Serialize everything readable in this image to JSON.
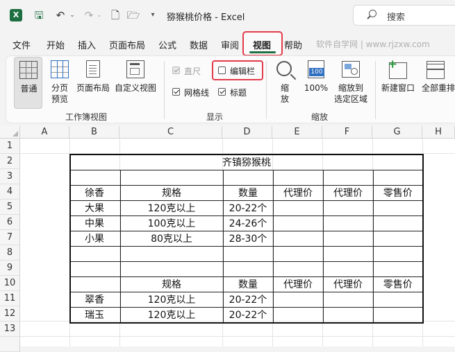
{
  "titlebar": {
    "app_icon": "excel-logo-icon",
    "app_icon_letter": "X",
    "doc_title": "猕猴桃价格  -  Excel",
    "search_placeholder": "搜索",
    "quick_access": {
      "save_icon": "save-icon",
      "undo_icon": "undo-icon",
      "redo_icon": "redo-icon",
      "new_icon": "new-document-icon",
      "open_icon": "open-folder-icon",
      "more_icon": "customize-quick-access-icon"
    }
  },
  "menu": {
    "tabs": [
      "文件",
      "开始",
      "插入",
      "页面布局",
      "公式",
      "数据",
      "审阅",
      "视图",
      "帮助"
    ],
    "active_tab": "视图",
    "watermark": "软件自学网 | www.rjzxw.com"
  },
  "ribbon": {
    "workbook_views": {
      "normal": "普通",
      "page_break_line1": "分页",
      "page_break_line2": "预览",
      "page_layout": "页面布局",
      "custom_views": "自定义视图",
      "group_label": "工作簿视图"
    },
    "show": {
      "ruler": {
        "label": "直尺",
        "checked": true,
        "disabled": true
      },
      "formula_bar": {
        "label": "编辑栏",
        "checked": false
      },
      "gridlines": {
        "label": "网格线",
        "checked": true
      },
      "headings": {
        "label": "标题",
        "checked": true
      },
      "group_label": "显示"
    },
    "zoom": {
      "zoom_line1": "缩",
      "zoom_line2": "放",
      "hundred": "100%",
      "hundred_icon_text": "100",
      "zoom_sel_line1": "缩放到",
      "zoom_sel_line2": "选定区域",
      "group_label": "缩放"
    },
    "window": {
      "new_window": "新建窗口",
      "arrange_all": "全部重排"
    }
  },
  "sheet": {
    "columns": [
      "A",
      "B",
      "C",
      "D",
      "E",
      "F",
      "G",
      "H"
    ],
    "rows": [
      "1",
      "2",
      "3",
      "4",
      "5",
      "6",
      "7",
      "8",
      "9",
      "10",
      "11",
      "12",
      "13"
    ],
    "table": {
      "title": "齐镇猕猴桃",
      "rows": [
        [
          "",
          "",
          "",
          "",
          "",
          ""
        ],
        [
          "徐香",
          "规格",
          "数量",
          "代理价",
          "代理价",
          "零售价"
        ],
        [
          "大果",
          "120克以上",
          "20-22个",
          "",
          "",
          ""
        ],
        [
          "中果",
          "100克以上",
          "24-26个",
          "",
          "",
          ""
        ],
        [
          "小果",
          "80克以上",
          "28-30个",
          "",
          "",
          ""
        ],
        [
          "",
          "",
          "",
          "",
          "",
          ""
        ],
        [
          "",
          "",
          "",
          "",
          "",
          ""
        ],
        [
          "",
          "规格",
          "数量",
          "代理价",
          "代理价",
          "零售价"
        ],
        [
          "翠香",
          "120克以上",
          "20-22个",
          "",
          "",
          ""
        ],
        [
          "瑞玉",
          "120克以上",
          "20-22个",
          "",
          "",
          ""
        ]
      ]
    }
  }
}
